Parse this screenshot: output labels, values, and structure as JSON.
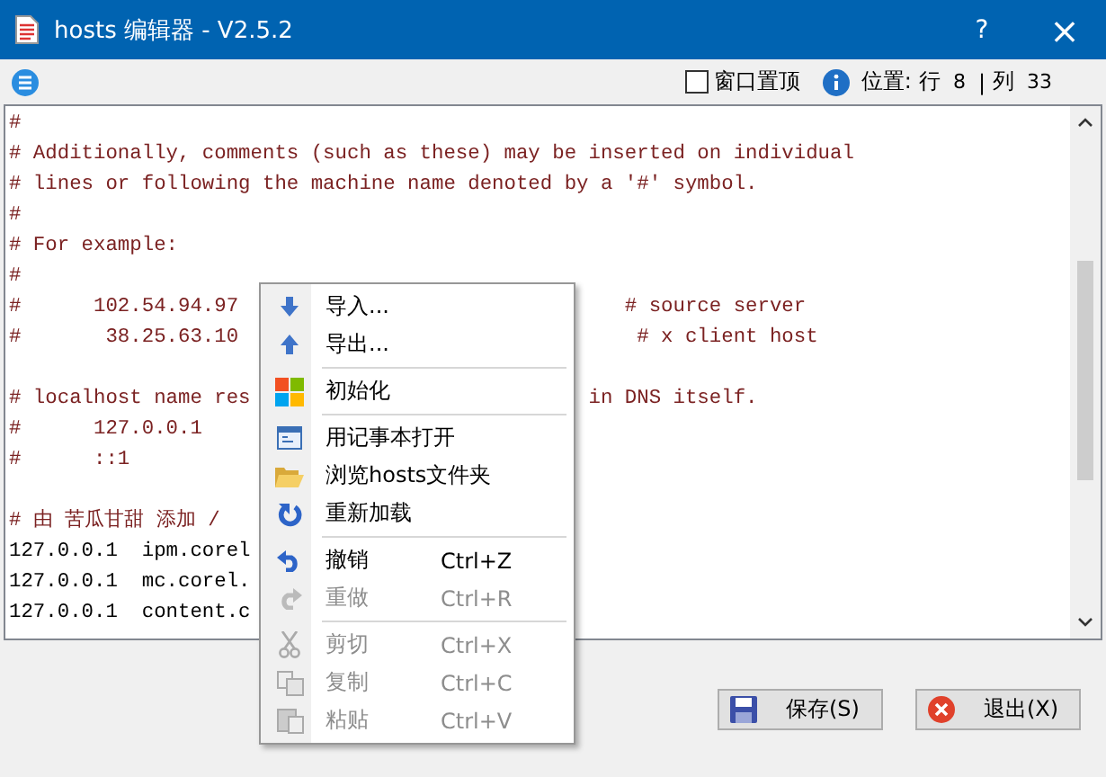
{
  "window": {
    "title": "hosts 编辑器 - V2.5.2",
    "help": "?",
    "close": "×"
  },
  "toolbar": {
    "pin_label": "窗口置顶",
    "pin_checked": false,
    "position_label": "位置:",
    "row_label": "行",
    "row": "8",
    "separator": "|",
    "col_label": "列",
    "col": "33"
  },
  "editor": {
    "lines": [
      {
        "kind": "comment",
        "text": "#"
      },
      {
        "kind": "comment",
        "text": "# Additionally, comments (such as these) may be inserted on individual"
      },
      {
        "kind": "comment",
        "text": "# lines or following the machine name denoted by a '#' symbol."
      },
      {
        "kind": "comment",
        "text": "#"
      },
      {
        "kind": "comment",
        "text": "# For example:"
      },
      {
        "kind": "comment",
        "text": "#"
      },
      {
        "kind": "comment",
        "text": "#      102.54.94.97",
        "right": "# source server"
      },
      {
        "kind": "comment",
        "text": "#       38.25.63.10",
        "right": "# x client host"
      },
      {
        "kind": "blank"
      },
      {
        "kind": "comment",
        "text": "# localhost name res",
        "right": "in DNS itself."
      },
      {
        "kind": "comment",
        "text": "#      127.0.0.1"
      },
      {
        "kind": "comment",
        "text": "#      ::1"
      },
      {
        "kind": "blank"
      },
      {
        "kind": "comment",
        "text": "# 由 苦瓜甘甜 添加 /"
      },
      {
        "kind": "entry",
        "text": "127.0.0.1  ipm.corel"
      },
      {
        "kind": "entry",
        "text": "127.0.0.1  mc.corel."
      },
      {
        "kind": "entry",
        "text": "127.0.0.1  content.c"
      }
    ]
  },
  "context_menu": [
    {
      "kind": "item",
      "label": "导入...",
      "disabled": false
    },
    {
      "kind": "item",
      "label": "导出...",
      "disabled": false
    },
    {
      "kind": "separator"
    },
    {
      "kind": "item",
      "label": "初始化",
      "disabled": false
    },
    {
      "kind": "separator"
    },
    {
      "kind": "item",
      "label": "用记事本打开",
      "disabled": false
    },
    {
      "kind": "item",
      "label": "浏览hosts文件夹",
      "disabled": false
    },
    {
      "kind": "item",
      "label": "重新加载",
      "disabled": false
    },
    {
      "kind": "separator"
    },
    {
      "kind": "item",
      "label": "撤销",
      "shortcut": "Ctrl+Z",
      "disabled": false
    },
    {
      "kind": "item",
      "label": "重做",
      "shortcut": "Ctrl+R",
      "disabled": true
    },
    {
      "kind": "separator"
    },
    {
      "kind": "item",
      "label": "剪切",
      "shortcut": "Ctrl+X",
      "disabled": true
    },
    {
      "kind": "item",
      "label": "复制",
      "shortcut": "Ctrl+C",
      "disabled": true
    },
    {
      "kind": "item",
      "label": "粘贴",
      "shortcut": "Ctrl+V",
      "disabled": true
    }
  ],
  "buttons": [
    {
      "kind": "save",
      "label": "保存(S)"
    },
    {
      "kind": "exit",
      "label": "退出(X)"
    }
  ]
}
